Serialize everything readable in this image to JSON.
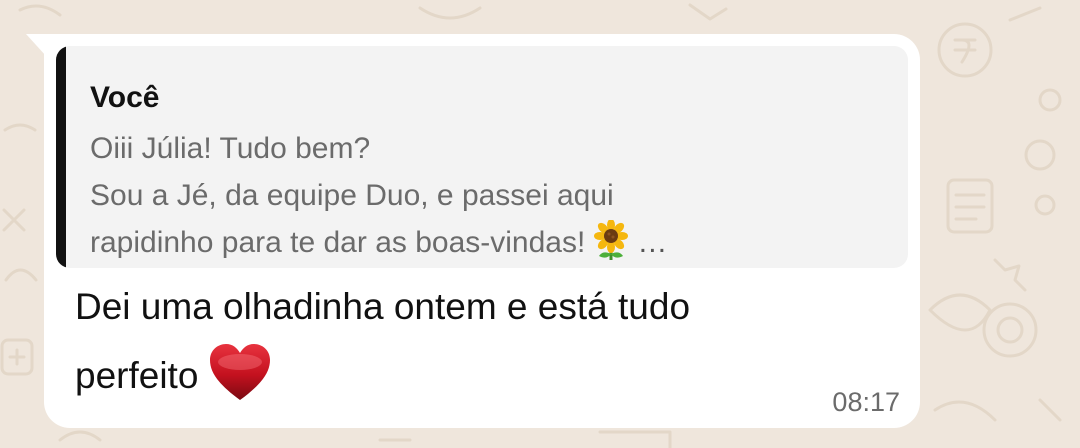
{
  "quoted_message": {
    "author": "Você",
    "lines": [
      "Oiii Júlia! Tudo bem?",
      "Sou a Jé, da equipe Duo, e passei aqui",
      "rapidinho para te dar as boas-vindas!"
    ],
    "emoji": "sunflower",
    "ellipsis": "…"
  },
  "message": {
    "lines": [
      "Dei uma olhadinha ontem e está tudo",
      "perfeito"
    ],
    "emoji": "red-heart",
    "time": "08:17"
  },
  "colors": {
    "wallpaper": "#efe6dc",
    "bubble": "#ffffff",
    "quote_background": "#f3f3f3",
    "quote_bar": "#111111",
    "quote_text": "#6b6b6b",
    "timestamp": "#6b6b6b"
  }
}
